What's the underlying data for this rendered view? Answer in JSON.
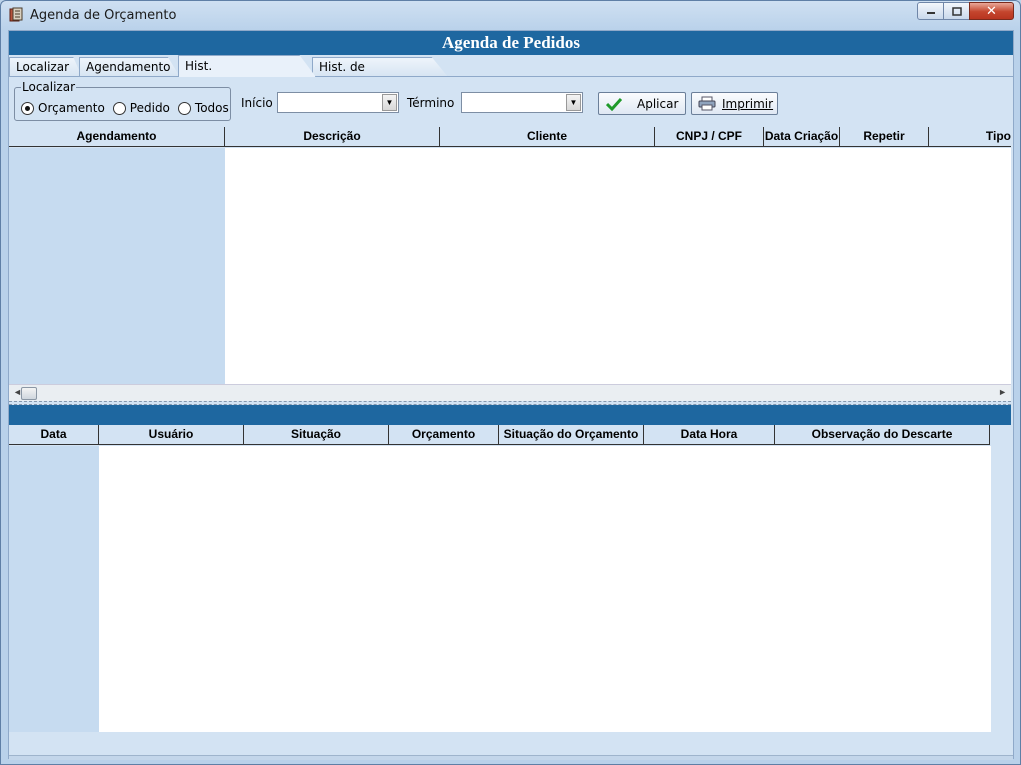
{
  "window": {
    "title": "Agenda de Orçamento",
    "minimize_label": "▭",
    "maximize_label": "□",
    "close_label": "✕"
  },
  "header": {
    "title": "Agenda de Pedidos"
  },
  "tabs": [
    {
      "label": "Localizar"
    },
    {
      "label": "Agendamento"
    },
    {
      "label": "Hist. Agendamentos"
    },
    {
      "label": "Hist. de Alterações"
    }
  ],
  "active_tab": "Hist. Agendamentos",
  "filters": {
    "group_label": "Localizar",
    "radios": [
      {
        "label": "Orçamento",
        "selected": true
      },
      {
        "label": "Pedido",
        "selected": false
      },
      {
        "label": "Todos",
        "selected": false
      }
    ],
    "inicio_label": "Início",
    "inicio_value": "",
    "termino_label": "Término",
    "termino_value": "",
    "apply_label": "Aplicar",
    "print_label": "Imprimir"
  },
  "grid_top": {
    "columns": [
      "Agendamento",
      "Descrição",
      "Cliente",
      "CNPJ / CPF",
      "Data Criação",
      "Repetir",
      "Tipo"
    ],
    "rows": []
  },
  "grid_bottom": {
    "columns": [
      "Data",
      "Usuário",
      "Situação",
      "Orçamento",
      "Situação do Orçamento",
      "Data Hora",
      "Observação do Descarte"
    ],
    "rows": []
  },
  "colors": {
    "accent": "#1e67a0",
    "panel": "#d3e3f3"
  }
}
